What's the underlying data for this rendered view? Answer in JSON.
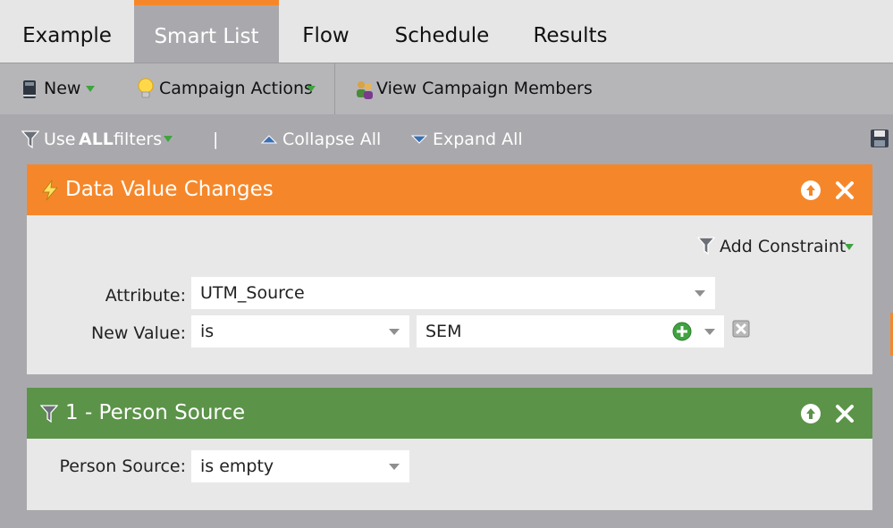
{
  "tabs": [
    {
      "label": "Example",
      "active": false
    },
    {
      "label": "Smart List",
      "active": true
    },
    {
      "label": "Flow",
      "active": false
    },
    {
      "label": "Schedule",
      "active": false
    },
    {
      "label": "Results",
      "active": false
    }
  ],
  "toolbar": {
    "new_label": "New",
    "campaign_actions_label": "Campaign Actions",
    "view_members_label": "View Campaign Members"
  },
  "filterbar": {
    "use_prefix": "Use ",
    "use_bold": "ALL",
    "use_suffix": " filters",
    "separator": "|",
    "collapse_label": "Collapse All",
    "expand_label": "Expand All"
  },
  "trigger": {
    "title": "Data Value Changes",
    "add_constraint_label": "Add Constraint",
    "attribute_label": "Attribute:",
    "attribute_value": "UTM_Source",
    "new_value_label": "New Value:",
    "operator_value": "is",
    "value_value": "SEM"
  },
  "filter": {
    "title": "1 - Person Source",
    "field_label": "Person Source:",
    "operator_value": "is empty"
  },
  "colors": {
    "accent_orange": "#f5872a",
    "filter_green": "#5b9348",
    "panel_gray": "#a9a9ad",
    "body_gray": "#e8e8e8"
  },
  "icons": {
    "new": "book-icon",
    "campaign_actions": "lightbulb-icon",
    "view_members": "people-icon",
    "filters": "funnel-icon",
    "trigger": "lightning-icon",
    "save": "floppy-disk-icon"
  }
}
